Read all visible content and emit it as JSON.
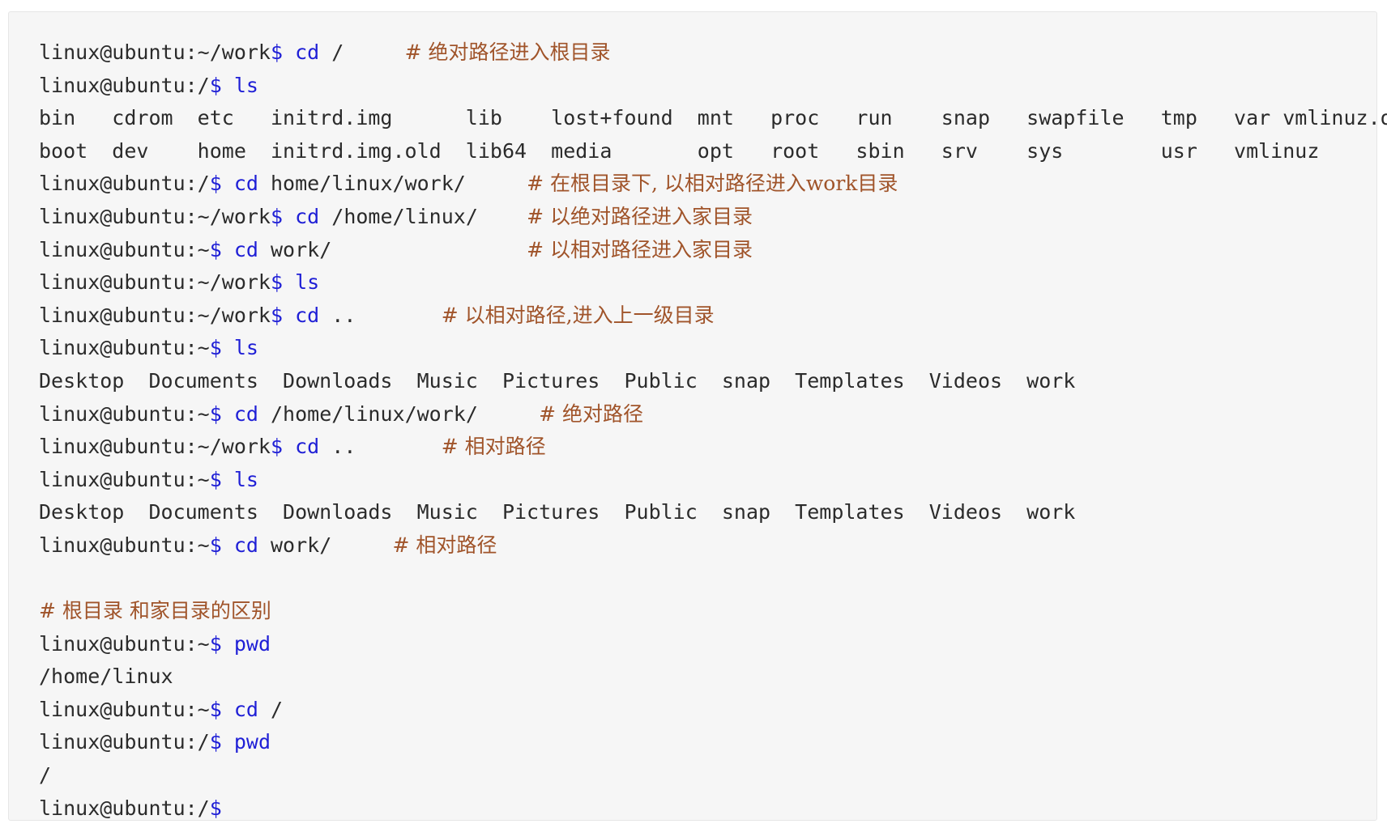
{
  "lines": [
    {
      "type": "cmd",
      "prompt": "linux@ubuntu:~/work",
      "cmd": "cd",
      "arg": " /",
      "pad": 5,
      "comment": "# 绝对路径进入根目录"
    },
    {
      "type": "cmd",
      "prompt": "linux@ubuntu:/",
      "cmd": "ls",
      "arg": "",
      "pad": 0,
      "comment": ""
    },
    {
      "type": "out",
      "text": "bin   cdrom  etc   initrd.img      lib    lost+found  mnt   proc   run    snap   swapfile   tmp   var vmlinuz.old"
    },
    {
      "type": "out",
      "text": "boot  dev    home  initrd.img.old  lib64  media       opt   root   sbin   srv    sys        usr   vmlinuz"
    },
    {
      "type": "cmd",
      "prompt": "linux@ubuntu:/",
      "cmd": "cd",
      "arg": " home/linux/work/",
      "pad": 5,
      "comment": "# 在根目录下, 以相对路径进入work目录"
    },
    {
      "type": "cmd",
      "prompt": "linux@ubuntu:~/work",
      "cmd": "cd",
      "arg": " /home/linux/",
      "pad": 4,
      "comment": "# 以绝对路径进入家目录"
    },
    {
      "type": "cmd",
      "prompt": "linux@ubuntu:~",
      "cmd": "cd",
      "arg": " work/",
      "pad": 16,
      "comment": "# 以相对路径进入家目录"
    },
    {
      "type": "cmd",
      "prompt": "linux@ubuntu:~/work",
      "cmd": "ls",
      "arg": "",
      "pad": 0,
      "comment": ""
    },
    {
      "type": "cmd",
      "prompt": "linux@ubuntu:~/work",
      "cmd": "cd",
      "arg": " ..",
      "pad": 7,
      "comment": "# 以相对路径,进入上一级目录"
    },
    {
      "type": "cmd",
      "prompt": "linux@ubuntu:~",
      "cmd": "ls",
      "arg": "",
      "pad": 0,
      "comment": ""
    },
    {
      "type": "out",
      "text": "Desktop  Documents  Downloads  Music  Pictures  Public  snap  Templates  Videos  work"
    },
    {
      "type": "cmd",
      "prompt": "linux@ubuntu:~",
      "cmd": "cd",
      "arg": " /home/linux/work/",
      "pad": 5,
      "comment": "# 绝对路径"
    },
    {
      "type": "cmd",
      "prompt": "linux@ubuntu:~/work",
      "cmd": "cd",
      "arg": " ..",
      "pad": 7,
      "comment": "# 相对路径"
    },
    {
      "type": "cmd",
      "prompt": "linux@ubuntu:~",
      "cmd": "ls",
      "arg": "",
      "pad": 0,
      "comment": ""
    },
    {
      "type": "out",
      "text": "Desktop  Documents  Downloads  Music  Pictures  Public  snap  Templates  Videos  work"
    },
    {
      "type": "cmd",
      "prompt": "linux@ubuntu:~",
      "cmd": "cd",
      "arg": " work/",
      "pad": 5,
      "comment": "# 相对路径"
    },
    {
      "type": "blank"
    },
    {
      "type": "comment",
      "comment": "# 根目录 和家目录的区别"
    },
    {
      "type": "cmd",
      "prompt": "linux@ubuntu:~",
      "cmd": "pwd",
      "arg": "",
      "pad": 0,
      "comment": ""
    },
    {
      "type": "out",
      "text": "/home/linux"
    },
    {
      "type": "cmd",
      "prompt": "linux@ubuntu:~",
      "cmd": "cd",
      "arg": " /",
      "pad": 0,
      "comment": ""
    },
    {
      "type": "cmd",
      "prompt": "linux@ubuntu:/",
      "cmd": "pwd",
      "arg": "",
      "pad": 0,
      "comment": ""
    },
    {
      "type": "out",
      "text": "/"
    },
    {
      "type": "cmd",
      "prompt": "linux@ubuntu:/",
      "cmd": "",
      "arg": "",
      "pad": 0,
      "comment": ""
    }
  ]
}
